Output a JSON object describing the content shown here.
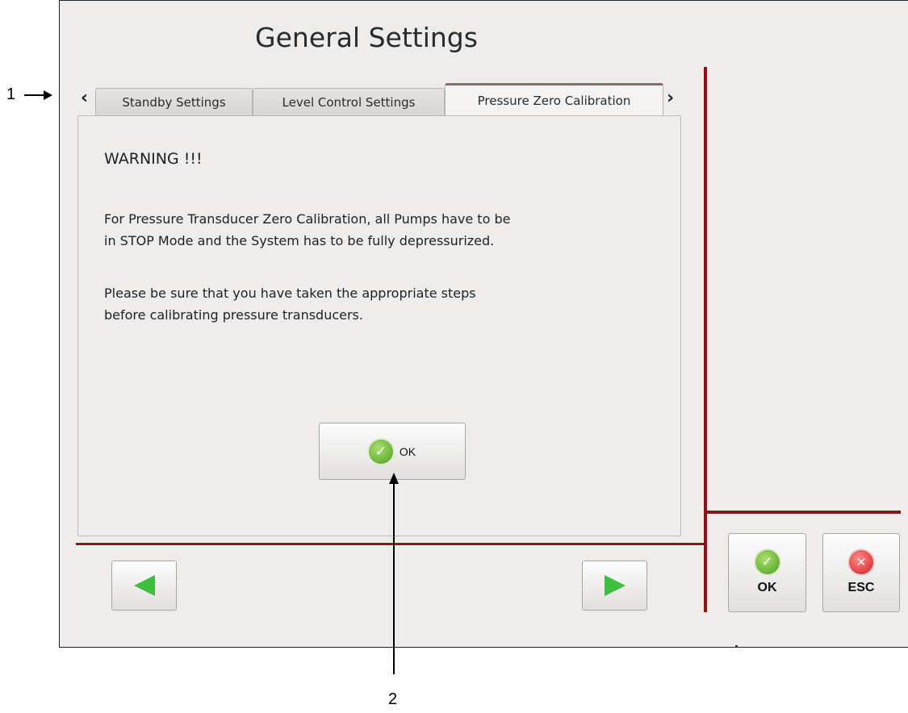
{
  "window": {
    "title": "General Settings"
  },
  "tabs": [
    {
      "label": "Standby Settings",
      "active": false
    },
    {
      "label": "Level Control Settings",
      "active": false
    },
    {
      "label": "Pressure Zero Calibration",
      "active": true
    }
  ],
  "tab_nav": {
    "prev_icon": "chevron-left-icon",
    "next_icon": "chevron-right-icon",
    "prev_glyph": "‹",
    "next_glyph": "›"
  },
  "panel": {
    "heading": "WARNING !!!",
    "paragraph1_line1": "For Pressure Transducer Zero Calibration, all Pumps have to be",
    "paragraph1_line2": "in STOP Mode and the System has to be fully depressurized.",
    "paragraph2_line1": "Please be sure that you have taken the appropriate steps",
    "paragraph2_line2": "before calibrating pressure transducers.",
    "ok_label": "OK"
  },
  "footer": {
    "ok_label": "OK",
    "esc_label": "ESC",
    "prev_icon": "arrow-left-icon",
    "next_icon": "arrow-right-icon"
  },
  "callouts": {
    "one": "1",
    "two": "2"
  },
  "colors": {
    "accent_line": "#8b1414",
    "ok_green": "#4f9d1f",
    "esc_red": "#d21e1e",
    "arrow_green": "#3fbf3f"
  }
}
